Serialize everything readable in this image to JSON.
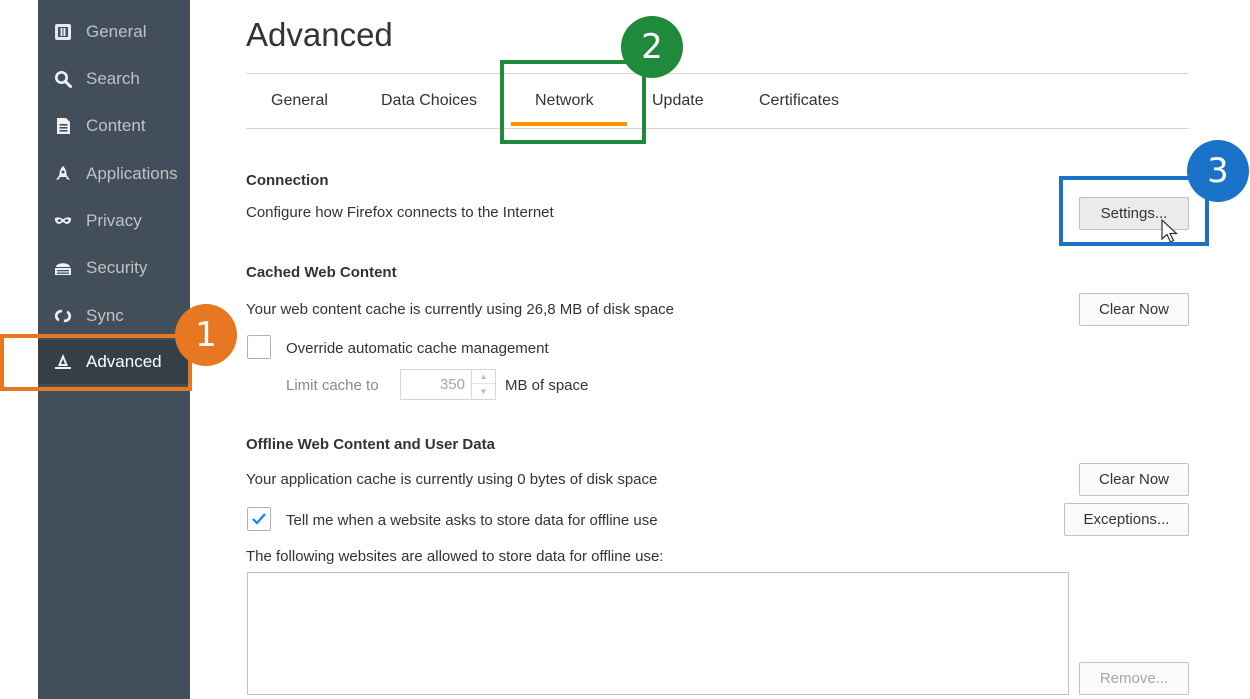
{
  "sidebar": {
    "items": [
      {
        "label": "General",
        "icon": "general-icon"
      },
      {
        "label": "Search",
        "icon": "search-icon"
      },
      {
        "label": "Content",
        "icon": "document-icon"
      },
      {
        "label": "Applications",
        "icon": "rocket-icon"
      },
      {
        "label": "Privacy",
        "icon": "mask-icon"
      },
      {
        "label": "Security",
        "icon": "security-icon"
      },
      {
        "label": "Sync",
        "icon": "sync-icon"
      },
      {
        "label": "Advanced",
        "icon": "wizard-hat-icon"
      }
    ],
    "selected": "Advanced"
  },
  "page": {
    "title": "Advanced"
  },
  "tabs": [
    {
      "label": "General"
    },
    {
      "label": "Data Choices"
    },
    {
      "label": "Network"
    },
    {
      "label": "Update"
    },
    {
      "label": "Certificates"
    }
  ],
  "selected_tab": "Network",
  "connection": {
    "title": "Connection",
    "description": "Configure how Firefox connects to the Internet",
    "settings_button": "Settings..."
  },
  "cached": {
    "title": "Cached Web Content",
    "description": "Your web content cache is currently using 26,8 MB of disk space",
    "clear_button": "Clear Now",
    "override_label": "Override automatic cache management",
    "override_checked": false,
    "limit_label": "Limit cache to",
    "limit_value": "350",
    "limit_unit": "MB of space"
  },
  "offline": {
    "title": "Offline Web Content and User Data",
    "description": "Your application cache is currently using 0 bytes of disk space",
    "clear_button": "Clear Now",
    "tell_label": "Tell me when a website asks to store data for offline use",
    "tell_checked": true,
    "exceptions_button": "Exceptions...",
    "allowed_label": "The following websites are allowed to store data for offline use:",
    "remove_button": "Remove..."
  },
  "callouts": [
    {
      "number": "1",
      "color": "#e87722"
    },
    {
      "number": "2",
      "color": "#1f8a3c"
    },
    {
      "number": "3",
      "color": "#1a73c9"
    }
  ],
  "colors": {
    "sidebar_bg": "#424f5a",
    "accent_tab": "#ff9500",
    "checkmark": "#0a84ff"
  }
}
